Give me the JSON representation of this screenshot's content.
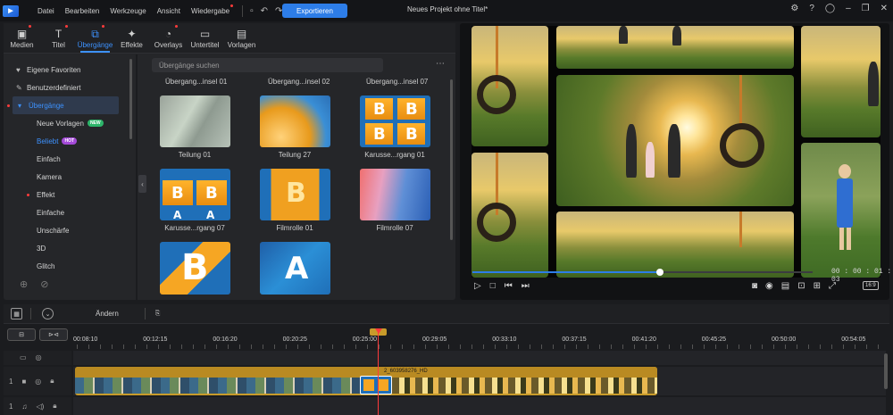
{
  "app": {
    "menu": [
      {
        "label": "Datei",
        "dot": false
      },
      {
        "label": "Bearbeiten",
        "dot": false
      },
      {
        "label": "Werkzeuge",
        "dot": false
      },
      {
        "label": "Ansicht",
        "dot": false
      },
      {
        "label": "Wiedergabe",
        "dot": true
      }
    ],
    "export_label": "Exportieren",
    "project_title": "Neues Projekt ohne Titel*",
    "accent": "#2d7de8"
  },
  "tabs": [
    {
      "label": "Medien",
      "icon": "media-icon",
      "glyph": "▣",
      "dot": true,
      "active": false
    },
    {
      "label": "Titel",
      "icon": "title-icon",
      "glyph": "T",
      "dot": true,
      "active": false
    },
    {
      "label": "Übergänge",
      "icon": "transition-icon",
      "glyph": "⧉",
      "dot": true,
      "active": true
    },
    {
      "label": "Effekte",
      "icon": "effects-icon",
      "glyph": "✦",
      "dot": false,
      "active": false
    },
    {
      "label": "Overlays",
      "icon": "overlays-icon",
      "glyph": "◔",
      "dot": true,
      "active": false
    },
    {
      "label": "Untertitel",
      "icon": "subtitle-icon",
      "glyph": "▭",
      "dot": false,
      "active": false
    },
    {
      "label": "Vorlagen",
      "icon": "templates-icon",
      "glyph": "▤",
      "dot": false,
      "active": false
    }
  ],
  "categories": {
    "favorites": "Eigene Favoriten",
    "custom": "Benutzerdefiniert",
    "transitions": "Übergänge",
    "items": [
      {
        "label": "Neue Vorlagen",
        "badge": "NEW"
      },
      {
        "label": "Beliebt",
        "badge": "HOT"
      },
      {
        "label": "Einfach"
      },
      {
        "label": "Kamera"
      },
      {
        "label": "Effekt"
      },
      {
        "label": "Einfache"
      },
      {
        "label": "Unschärfe"
      },
      {
        "label": "3D"
      },
      {
        "label": "Glitch"
      }
    ]
  },
  "search": {
    "placeholder": "Übergänge suchen"
  },
  "grid": {
    "cut_labels": [
      "Übergang...insel 01",
      "Übergang...insel 02",
      "Übergang...insel 07"
    ],
    "items": [
      {
        "label": "Teilung 01"
      },
      {
        "label": "Teilung 27"
      },
      {
        "label": "Karusse...rgang 01"
      },
      {
        "label": "Karusse...rgang 07"
      },
      {
        "label": "Filmrolle 01"
      },
      {
        "label": "Filmrolle 07"
      },
      {
        "label": ""
      },
      {
        "label": ""
      }
    ],
    "letters": {
      "b": "B",
      "a": "A"
    }
  },
  "preview": {
    "timecode": "00 : 00 : 01 : 03",
    "progress": 0.55,
    "ratio": "16:9"
  },
  "timeline": {
    "edit_label": "Ändern",
    "ticks": [
      "00:08:10",
      "00:12:15",
      "00:16:20",
      "00:20:25",
      "00:25:00",
      "00:29:05",
      "00:33:10",
      "00:37:15",
      "00:41:20",
      "00:45:25",
      "00:50:00",
      "00:54:05"
    ],
    "track_video_num": "1",
    "track_audio_num": "1",
    "clip_name": "2_603958276_HD"
  }
}
